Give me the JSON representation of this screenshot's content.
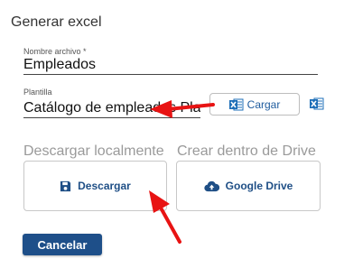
{
  "dialog": {
    "title": "Generar excel"
  },
  "file_name": {
    "label": "Nombre archivo",
    "required_mark": "*",
    "value": "Empleados"
  },
  "template": {
    "label": "Plantilla",
    "value": "Catálogo de empleados Plantilla"
  },
  "upload": {
    "label": "Cargar",
    "icon": "excel-icon"
  },
  "download_section": {
    "label": "Descargar localmente",
    "button_label": "Descargar",
    "icon": "save-icon"
  },
  "drive_section": {
    "label": "Crear dentro de Drive",
    "button_label": "Google Drive",
    "icon": "cloud-upload-icon"
  },
  "cancel": {
    "label": "Cancelar"
  },
  "colors": {
    "accent": "#1e4f89",
    "link": "#1f5c9e",
    "excel": "#1e6fb8",
    "annotation": "#e81313"
  }
}
